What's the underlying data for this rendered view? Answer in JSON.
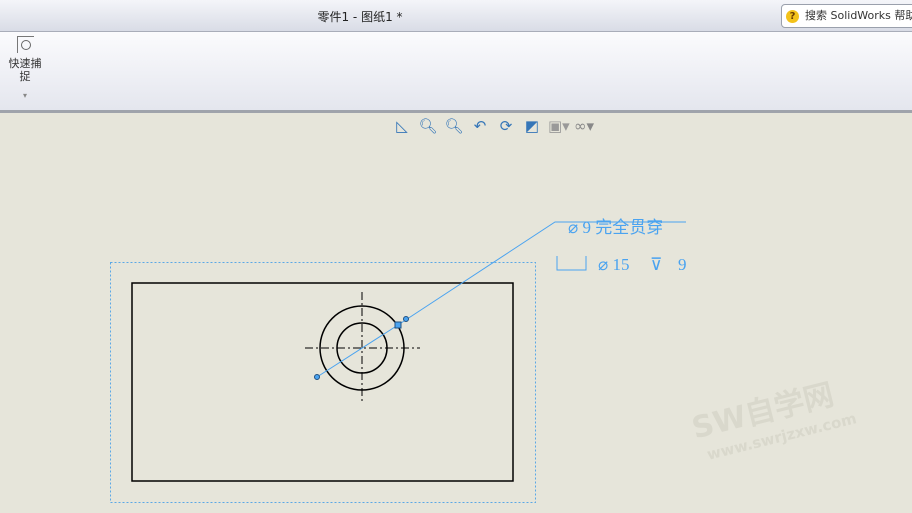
{
  "window": {
    "title": "零件1 - 图纸1 *"
  },
  "help": {
    "search_label": "搜索 SolidWorks 帮助"
  },
  "ribbon": {
    "quick_snap_label": "快速捕捉"
  },
  "view_toolbar": [
    "view-orientation-icon",
    "zoom-to-fit-icon",
    "zoom-to-area-icon",
    "previous-view-icon",
    "rebuild-icon",
    "display-style-icon",
    "hide-show-icon",
    "view-settings-icon"
  ],
  "annotation": {
    "line1": "⌀ 9 完全贯穿",
    "line2_prefix": "⌀ 15",
    "line2_depth": "9"
  },
  "watermark": {
    "brand": "SW自学网",
    "url": "www.swrjzxw.com"
  },
  "colors": {
    "annotation": "#4aa3f0",
    "background": "#e6e5da"
  }
}
